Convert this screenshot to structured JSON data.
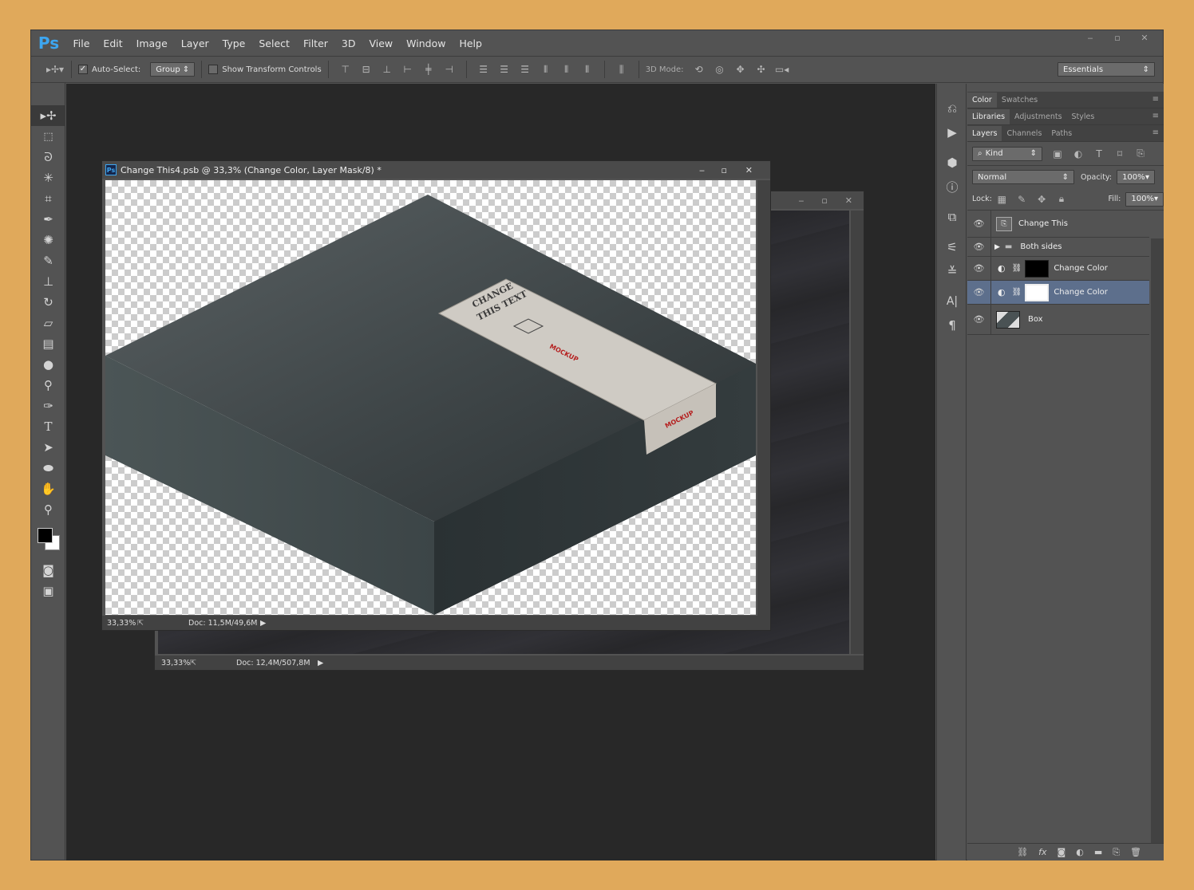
{
  "app": {
    "logo": "Ps",
    "menu": [
      "File",
      "Edit",
      "Image",
      "Layer",
      "Type",
      "Select",
      "Filter",
      "3D",
      "View",
      "Window",
      "Help"
    ],
    "window_controls": [
      "‒",
      "▫",
      "✕"
    ]
  },
  "options_bar": {
    "auto_select_label": "Auto-Select:",
    "auto_select_checked": true,
    "auto_select_value": "Group",
    "show_transform_label": "Show Transform Controls",
    "mode_3d_label": "3D Mode:",
    "workspace_value": "Essentials"
  },
  "tools": [
    "move-tool",
    "marquee-tool",
    "lasso-tool",
    "magic-wand-tool",
    "crop-tool",
    "eyedropper-tool",
    "spot-heal-tool",
    "brush-tool",
    "clone-stamp-tool",
    "history-brush-tool",
    "eraser-tool",
    "gradient-tool",
    "blur-tool",
    "dodge-tool",
    "pen-tool",
    "type-tool",
    "path-select-tool",
    "ellipse-tool",
    "hand-tool",
    "zoom-tool"
  ],
  "doc_front": {
    "title": "Change This4.psb @ 33,3% (Change Color, Layer Mask/8) *",
    "zoom": "33,33%",
    "doc_size": "Doc: 11,5M/49,6M"
  },
  "doc_back": {
    "zoom": "33,33%",
    "doc_size": "Doc: 12,4M/507,8M"
  },
  "mockup_label": {
    "line1": "CHANGE",
    "line2": "THIS TEXT",
    "brand": "MOCKUP",
    "side": "MOCKUP"
  },
  "panels": {
    "color_tabs": [
      "Color",
      "Swatches"
    ],
    "library_tabs": [
      "Libraries",
      "Adjustments",
      "Styles"
    ],
    "layer_tabs": [
      "Layers",
      "Channels",
      "Paths"
    ],
    "kind_filter": "Kind",
    "blend_mode": "Normal",
    "opacity_label": "Opacity:",
    "opacity_value": "100%",
    "lock_label": "Lock:",
    "fill_label": "Fill:",
    "fill_value": "100%",
    "layers": [
      {
        "name": "Change This",
        "type": "smart"
      },
      {
        "name": "Both sides",
        "type": "group"
      },
      {
        "name": "Change Color",
        "type": "adjust-mask"
      },
      {
        "name": "Change Color",
        "type": "adjust-mask",
        "selected": true
      },
      {
        "name": "Box",
        "type": "pixel"
      }
    ]
  },
  "colors": {
    "background": "#e0a95b",
    "ui": "#535353",
    "workspace": "#282828",
    "selected_layer": "#5d6f8c",
    "ps_blue": "#3da6f0"
  }
}
